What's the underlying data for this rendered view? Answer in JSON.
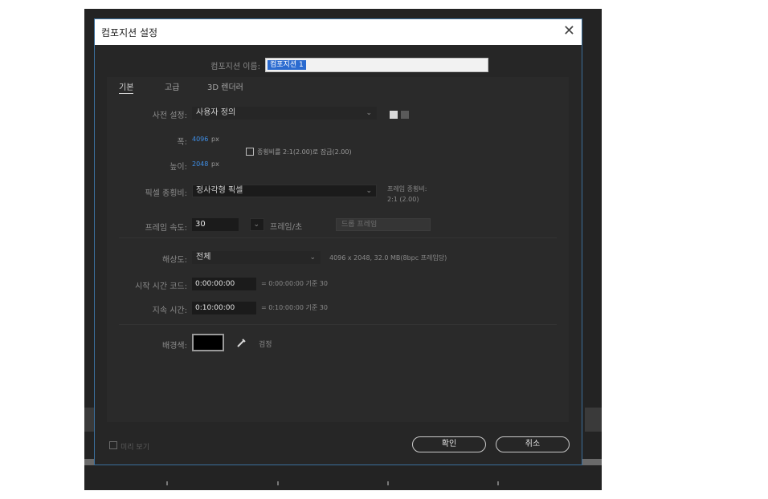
{
  "dialog": {
    "title": "컴포지션 설정",
    "name_label": "컴포지션 이름:",
    "name_value": "컴포지션 1",
    "tabs": [
      "기본",
      "고급",
      "3D 렌더러"
    ],
    "preset_label": "사전 설정:",
    "preset_value": "사용자 정의",
    "width_label": "폭:",
    "width_value": "4096",
    "width_unit": "px",
    "height_label": "높이:",
    "height_value": "2048",
    "height_unit": "px",
    "lock_aspect_label": "종횡비를 2:1(2.00)로 잠금(2.00)",
    "pixel_aspect_label": "픽셀 종횡비:",
    "pixel_aspect_value": "정사각형 픽셀",
    "frame_aspect_label": "프레임 종횡비:",
    "frame_aspect_value": "2:1 (2.00)",
    "frame_rate_label": "프레임 속도:",
    "frame_rate_value": "30",
    "frame_rate_unit": "프레임/초",
    "drop_frame_value": "드롭 프레임",
    "resolution_label": "해상도:",
    "resolution_value": "전체",
    "resolution_info": "4096 x 2048, 32.0 MB(8bpc 프레임당)",
    "start_tc_label": "시작 시간 코드:",
    "start_tc_value": "0:00:00:00",
    "start_tc_info": "= 0:00:00:00  기준 30",
    "duration_label": "지속 시간:",
    "duration_value": "0:10:00:00",
    "duration_info": "= 0:10:00:00  기준 30",
    "bg_color_label": "배경색:",
    "bg_color_name": "검정",
    "bg_color_hex": "#000000",
    "preview_label": "미리 보기",
    "ok_label": "확인",
    "cancel_label": "취소"
  },
  "colors": {
    "accent": "#3e8ee6",
    "selection": "#2b6bd0",
    "border": "#3b6f9c"
  },
  "icons": [
    "close-icon",
    "save-preset-icon",
    "delete-preset-icon",
    "eyedropper-icon",
    "chevron-down-icon"
  ]
}
